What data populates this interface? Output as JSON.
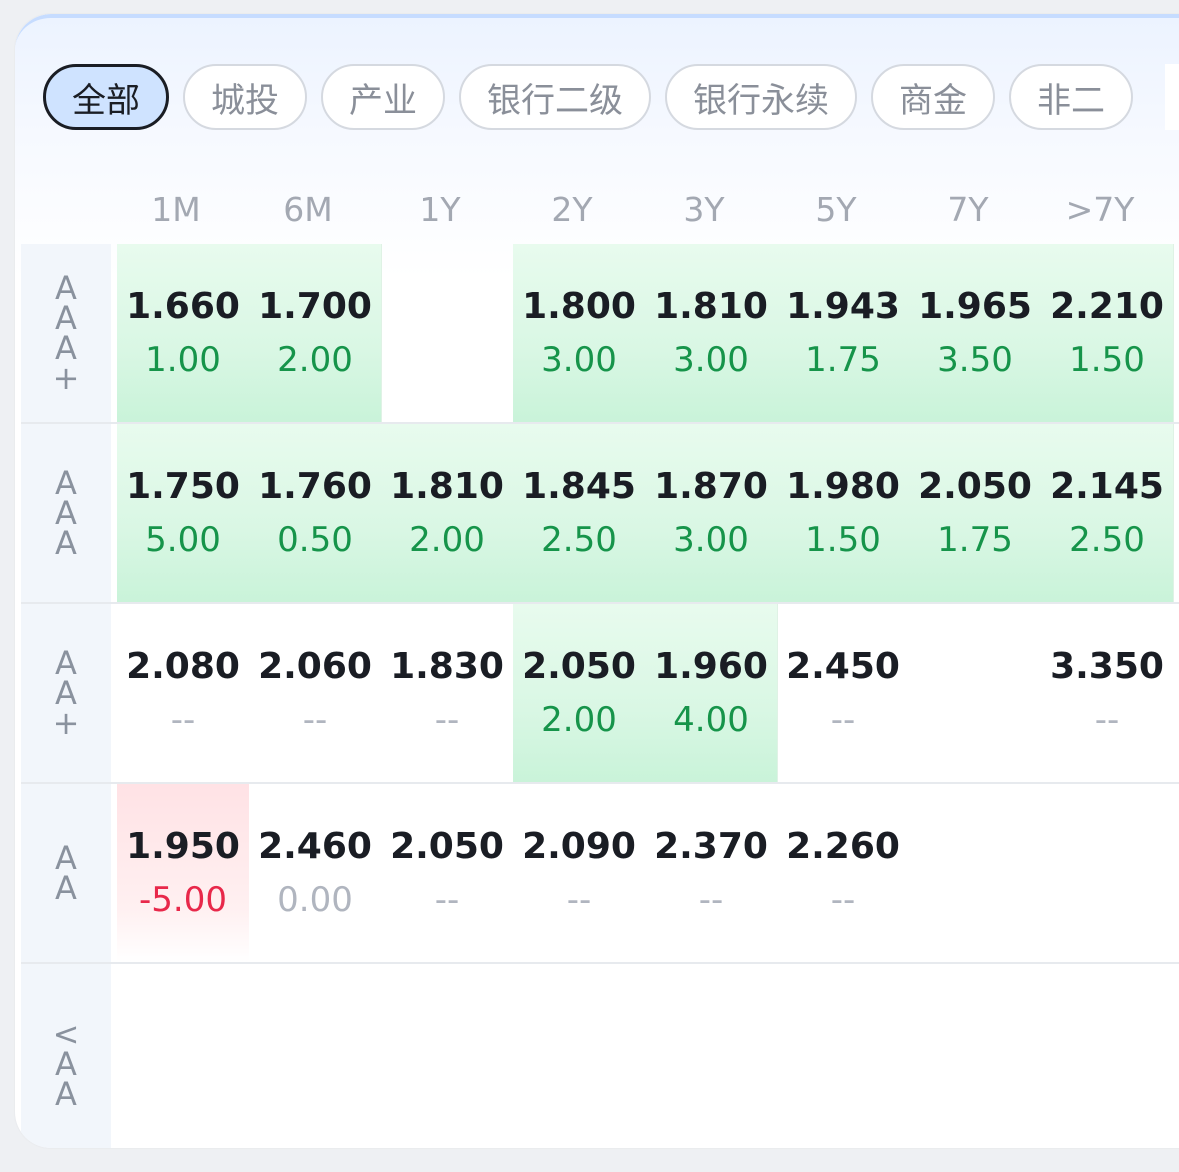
{
  "tabs": [
    "全部",
    "城投",
    "产业",
    "银行二级",
    "银行永续",
    "商金",
    "非二"
  ],
  "active_tab": 0,
  "periods": [
    "1M",
    "6M",
    "1Y",
    "2Y",
    "3Y",
    "5Y",
    "7Y",
    ">7Y"
  ],
  "rows": [
    {
      "label": [
        "A",
        "A",
        "A",
        "+"
      ],
      "cells": [
        {
          "yield": "1.660",
          "change": "1.00",
          "tone": "pos",
          "bg": "green"
        },
        {
          "yield": "1.700",
          "change": "2.00",
          "tone": "pos",
          "bg": "green"
        },
        {
          "yield": "",
          "change": "",
          "tone": "neutral",
          "bg": "none"
        },
        {
          "yield": "1.800",
          "change": "3.00",
          "tone": "pos",
          "bg": "green"
        },
        {
          "yield": "1.810",
          "change": "3.00",
          "tone": "pos",
          "bg": "green"
        },
        {
          "yield": "1.943",
          "change": "1.75",
          "tone": "pos",
          "bg": "green"
        },
        {
          "yield": "1.965",
          "change": "3.50",
          "tone": "pos",
          "bg": "green"
        },
        {
          "yield": "2.210",
          "change": "1.50",
          "tone": "pos",
          "bg": "green"
        }
      ]
    },
    {
      "label": [
        "A",
        "A",
        "A"
      ],
      "cells": [
        {
          "yield": "1.750",
          "change": "5.00",
          "tone": "pos",
          "bg": "green"
        },
        {
          "yield": "1.760",
          "change": "0.50",
          "tone": "pos",
          "bg": "green"
        },
        {
          "yield": "1.810",
          "change": "2.00",
          "tone": "pos",
          "bg": "green"
        },
        {
          "yield": "1.845",
          "change": "2.50",
          "tone": "pos",
          "bg": "green"
        },
        {
          "yield": "1.870",
          "change": "3.00",
          "tone": "pos",
          "bg": "green"
        },
        {
          "yield": "1.980",
          "change": "1.50",
          "tone": "pos",
          "bg": "green"
        },
        {
          "yield": "2.050",
          "change": "1.75",
          "tone": "pos",
          "bg": "green"
        },
        {
          "yield": "2.145",
          "change": "2.50",
          "tone": "pos",
          "bg": "green"
        }
      ]
    },
    {
      "label": [
        "A",
        "A",
        "+"
      ],
      "cells": [
        {
          "yield": "2.080",
          "change": "--",
          "tone": "neutral",
          "bg": "none"
        },
        {
          "yield": "2.060",
          "change": "--",
          "tone": "neutral",
          "bg": "none"
        },
        {
          "yield": "1.830",
          "change": "--",
          "tone": "neutral",
          "bg": "none"
        },
        {
          "yield": "2.050",
          "change": "2.00",
          "tone": "pos",
          "bg": "green"
        },
        {
          "yield": "1.960",
          "change": "4.00",
          "tone": "pos",
          "bg": "green"
        },
        {
          "yield": "2.450",
          "change": "--",
          "tone": "neutral",
          "bg": "none"
        },
        {
          "yield": "",
          "change": "",
          "tone": "neutral",
          "bg": "none"
        },
        {
          "yield": "3.350",
          "change": "--",
          "tone": "neutral",
          "bg": "none"
        }
      ]
    },
    {
      "label": [
        "A",
        "A"
      ],
      "cells": [
        {
          "yield": "1.950",
          "change": "-5.00",
          "tone": "neg",
          "bg": "red"
        },
        {
          "yield": "2.460",
          "change": "0.00",
          "tone": "neutral",
          "bg": "none"
        },
        {
          "yield": "2.050",
          "change": "--",
          "tone": "neutral",
          "bg": "none"
        },
        {
          "yield": "2.090",
          "change": "--",
          "tone": "neutral",
          "bg": "none"
        },
        {
          "yield": "2.370",
          "change": "--",
          "tone": "neutral",
          "bg": "none"
        },
        {
          "yield": "2.260",
          "change": "--",
          "tone": "neutral",
          "bg": "none"
        },
        {
          "yield": "",
          "change": "",
          "tone": "neutral",
          "bg": "none"
        },
        {
          "yield": "",
          "change": "",
          "tone": "neutral",
          "bg": "none"
        }
      ]
    },
    {
      "label": [
        "<",
        "A",
        "A"
      ],
      "cells": []
    }
  ],
  "colors": {
    "positive": "#16944a",
    "negative": "#e8284a",
    "neutral": "#b0b5bf",
    "active_tab_bg": "#cfe3ff"
  }
}
